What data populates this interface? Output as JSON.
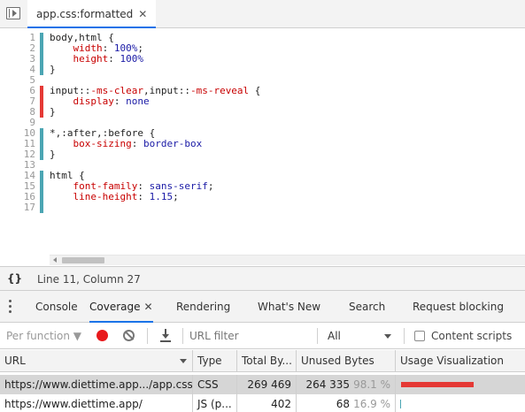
{
  "editor_tab": {
    "file_name": "app.css:formatted",
    "close_glyph": "✕"
  },
  "code_lines": [
    {
      "num": "1",
      "coverage": "used",
      "tokens": [
        {
          "t": "body,html {",
          "c": "sel"
        }
      ]
    },
    {
      "num": "2",
      "coverage": "used",
      "tokens": [
        {
          "t": "    ",
          "c": "punc"
        },
        {
          "t": "width",
          "c": "prop"
        },
        {
          "t": ": ",
          "c": "punc"
        },
        {
          "t": "100%",
          "c": "val"
        },
        {
          "t": ";",
          "c": "punc"
        }
      ]
    },
    {
      "num": "3",
      "coverage": "used",
      "tokens": [
        {
          "t": "    ",
          "c": "punc"
        },
        {
          "t": "height",
          "c": "prop"
        },
        {
          "t": ": ",
          "c": "punc"
        },
        {
          "t": "100%",
          "c": "val"
        }
      ]
    },
    {
      "num": "4",
      "coverage": "used",
      "tokens": [
        {
          "t": "}",
          "c": "punc"
        }
      ]
    },
    {
      "num": "5",
      "coverage": "none",
      "tokens": []
    },
    {
      "num": "6",
      "coverage": "unused",
      "tokens": [
        {
          "t": "input::",
          "c": "sel"
        },
        {
          "t": "-ms-clear",
          "c": "prop"
        },
        {
          "t": ",input::",
          "c": "sel"
        },
        {
          "t": "-ms-reveal",
          "c": "prop"
        },
        {
          "t": " {",
          "c": "punc"
        }
      ]
    },
    {
      "num": "7",
      "coverage": "unused",
      "tokens": [
        {
          "t": "    ",
          "c": "punc"
        },
        {
          "t": "display",
          "c": "prop"
        },
        {
          "t": ": ",
          "c": "punc"
        },
        {
          "t": "none",
          "c": "val"
        }
      ]
    },
    {
      "num": "8",
      "coverage": "unused",
      "tokens": [
        {
          "t": "}",
          "c": "punc"
        }
      ]
    },
    {
      "num": "9",
      "coverage": "none",
      "tokens": []
    },
    {
      "num": "10",
      "coverage": "used",
      "tokens": [
        {
          "t": "*,:after,:before {",
          "c": "sel"
        }
      ]
    },
    {
      "num": "11",
      "coverage": "used",
      "tokens": [
        {
          "t": "    ",
          "c": "punc"
        },
        {
          "t": "box-sizing",
          "c": "prop"
        },
        {
          "t": ": ",
          "c": "punc"
        },
        {
          "t": "border-box",
          "c": "val"
        }
      ]
    },
    {
      "num": "12",
      "coverage": "used",
      "tokens": [
        {
          "t": "}",
          "c": "punc"
        }
      ]
    },
    {
      "num": "13",
      "coverage": "none",
      "tokens": []
    },
    {
      "num": "14",
      "coverage": "used",
      "tokens": [
        {
          "t": "html {",
          "c": "sel"
        }
      ]
    },
    {
      "num": "15",
      "coverage": "used",
      "tokens": [
        {
          "t": "    ",
          "c": "punc"
        },
        {
          "t": "font-family",
          "c": "prop"
        },
        {
          "t": ": ",
          "c": "punc"
        },
        {
          "t": "sans-serif",
          "c": "val"
        },
        {
          "t": ";",
          "c": "punc"
        }
      ]
    },
    {
      "num": "16",
      "coverage": "used",
      "tokens": [
        {
          "t": "    ",
          "c": "punc"
        },
        {
          "t": "line-height",
          "c": "prop"
        },
        {
          "t": ": ",
          "c": "punc"
        },
        {
          "t": "1.15",
          "c": "val"
        },
        {
          "t": ";",
          "c": "punc"
        }
      ]
    },
    {
      "num": "17",
      "coverage": "used",
      "tokens": []
    }
  ],
  "status": {
    "braces_icon": "{}",
    "cursor_position": "Line 11, Column 27"
  },
  "drawer_tabs": [
    {
      "id": "console",
      "label": "Console",
      "active": false,
      "closable": false
    },
    {
      "id": "coverage",
      "label": "Coverage",
      "active": true,
      "closable": true
    },
    {
      "id": "rendering",
      "label": "Rendering",
      "active": false,
      "closable": false
    },
    {
      "id": "whats-new",
      "label": "What's New",
      "active": false,
      "closable": false
    },
    {
      "id": "search",
      "label": "Search",
      "active": false,
      "closable": false
    },
    {
      "id": "request-blocking",
      "label": "Request blocking",
      "active": false,
      "closable": false
    }
  ],
  "toolbar": {
    "per_function": "Per function ▼",
    "url_filter_placeholder": "URL filter",
    "type_value": "All",
    "content_scripts_label": "Content scripts",
    "content_scripts_checked": false
  },
  "table": {
    "columns": [
      "URL",
      "Type",
      "Total By...",
      "Unused Bytes",
      "Usage Visualization"
    ],
    "rows": [
      {
        "url": "https://www.diettime.app.../app.css",
        "type": "CSS",
        "total": "269 469",
        "unused": "264 335",
        "unused_pct": "98.1 %",
        "unused_fraction": 0.981,
        "bar_scale": 1.0,
        "selected": true
      },
      {
        "url": "https://www.diettime.app/",
        "type": "JS (p...",
        "total": "402",
        "unused": "68",
        "unused_pct": "16.9 %",
        "unused_fraction": 0.169,
        "bar_scale": 0.0015,
        "selected": false
      }
    ]
  },
  "colors": {
    "accent": "#1a73e8",
    "used": "#4ba5b3",
    "unused": "#e53935",
    "record": "#e8191c"
  }
}
